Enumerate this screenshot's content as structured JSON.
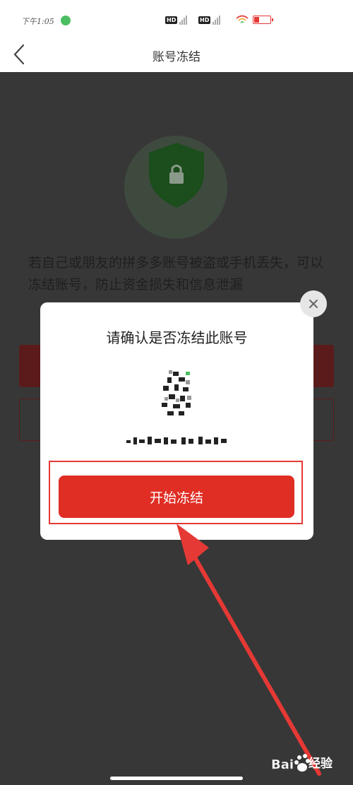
{
  "status_bar": {
    "time": "下午1:05",
    "hd1": "HD",
    "hd2": "HD"
  },
  "nav": {
    "title": "账号冻结",
    "back_icon": "chevron-left-icon"
  },
  "main": {
    "shield_icon": "shield-lock-icon",
    "description": "若自己或朋友的拼多多账号被盗或手机丢失，可以冻结账号，防止资金损失和信息泄漏"
  },
  "dialog": {
    "title": "请确认是否冻结此账号",
    "button_label": "开始冻结",
    "close_icon": "close-icon"
  },
  "watermark": {
    "text": "经验"
  },
  "colors": {
    "accent": "#e02e24",
    "overlay": "#373737",
    "annotation": "#e53935"
  }
}
